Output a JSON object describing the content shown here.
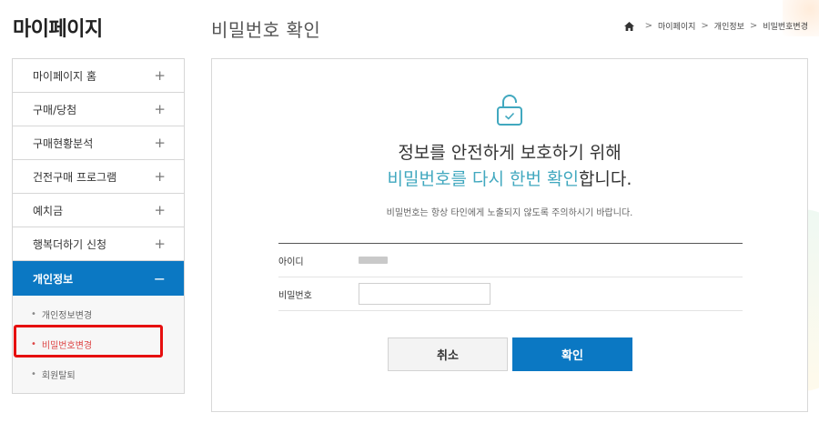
{
  "sidebar": {
    "title": "마이페이지",
    "menu": [
      {
        "label": "마이페이지 홈",
        "toggle": "+"
      },
      {
        "label": "구매/당첨",
        "toggle": "+"
      },
      {
        "label": "구매현황분석",
        "toggle": "+"
      },
      {
        "label": "건전구매 프로그램",
        "toggle": "+"
      },
      {
        "label": "예치금",
        "toggle": "+"
      },
      {
        "label": "행복더하기 신청",
        "toggle": "+"
      },
      {
        "label": "개인정보",
        "toggle": "−"
      }
    ],
    "submenu": [
      {
        "label": "개인정보변경"
      },
      {
        "label": "비밀번호변경"
      },
      {
        "label": "회원탈퇴"
      }
    ],
    "dot": "•"
  },
  "header": {
    "title": "비밀번호 확인",
    "breadcrumb": [
      "마이페이지",
      "개인정보",
      "비밀번호변경"
    ],
    "separator": ">"
  },
  "card": {
    "icon": "lock-check-icon",
    "headline_line1": "정보를 안전하게 보호하기 위해",
    "headline_line2_accent": "비밀번호를 다시 한번 확인",
    "headline_line2_rest": "합니다.",
    "notice": "비밀번호는 항상 타인에게 노출되지 않도록 주의하시기 바랍니다.",
    "form": {
      "id_label": "아이디",
      "password_label": "비밀번호",
      "password_value": ""
    },
    "buttons": {
      "cancel": "취소",
      "confirm": "확인"
    }
  },
  "colors": {
    "primary": "#0b78c3",
    "accent_text": "#41a8bf",
    "highlight_box": "#e60f0f"
  }
}
